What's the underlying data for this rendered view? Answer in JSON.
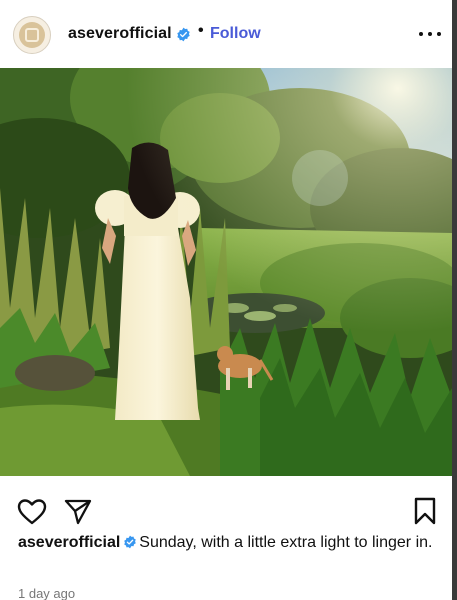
{
  "post": {
    "username": "aseverofficial",
    "separator": "•",
    "follow_label": "Follow",
    "caption_user": "aseverofficial",
    "caption_text": "Sunday, with a little extra light to linger in.",
    "timestamp": "1 day ago"
  },
  "icons": {
    "avatar": "brand-logo-icon",
    "verified": "verified-badge-icon",
    "more": "more-options-icon",
    "like": "heart-icon",
    "share": "paper-plane-icon",
    "save": "bookmark-icon"
  },
  "colors": {
    "follow": "#4a5bd7",
    "verified": "#3897f0",
    "timestamp": "#777777"
  }
}
